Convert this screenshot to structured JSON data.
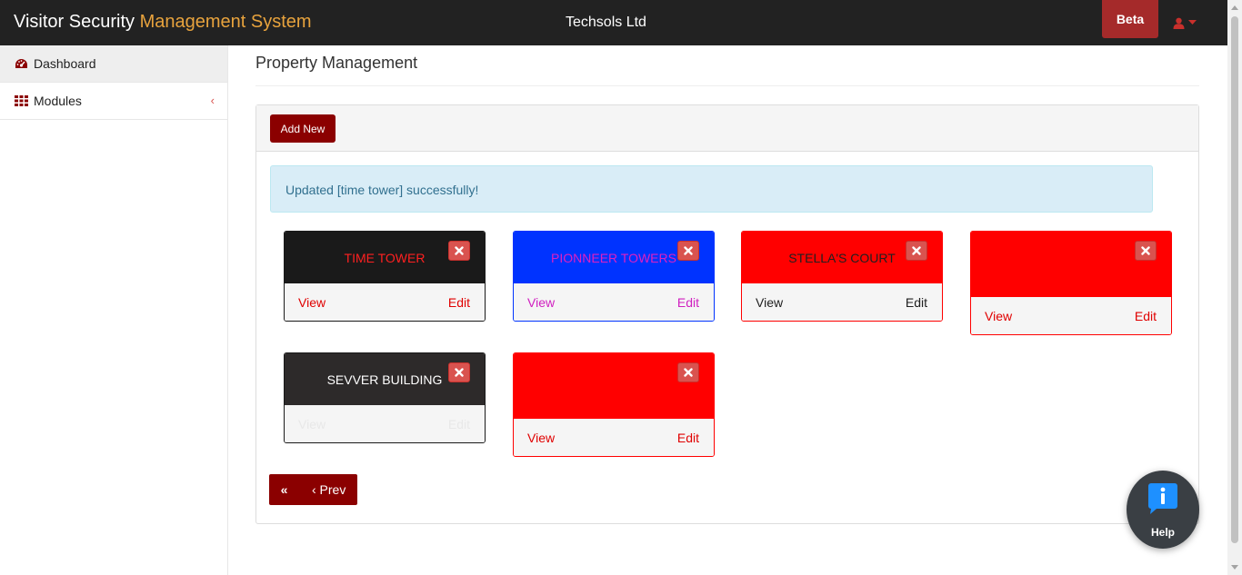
{
  "header": {
    "brand_part1": "Visitor Security ",
    "brand_part2": "Management System",
    "company": "Techsols Ltd",
    "beta_label": "Beta",
    "brand_accent_color": "#e8a33d",
    "user_icon": "user-icon",
    "caret_icon": "caret-down-icon"
  },
  "sidebar": {
    "items": [
      {
        "label": "Dashboard",
        "icon": "dashboard-icon"
      },
      {
        "label": "Modules",
        "icon": "grid-icon",
        "chevron": "‹"
      }
    ]
  },
  "main": {
    "page_title": "Property Management",
    "add_button": "Add New",
    "alert_text": "Updated [time tower] successfully!",
    "view_label": "View",
    "edit_label": "Edit",
    "cards": [
      {
        "name": "TIME TOWER",
        "top_bg": "#1a1a1a",
        "name_color": "#ff2020",
        "border": "#1a1a1a",
        "link_color": "#e00000",
        "faded": false
      },
      {
        "name": "PIONNEER TOWERS",
        "top_bg": "#0033ff",
        "name_color": "#e020c0",
        "border": "#0033ff",
        "link_color": "#d020c0",
        "faded": false
      },
      {
        "name": "STELLA'S COURT",
        "top_bg": "#ff0000",
        "name_color": "#202020",
        "border": "#ff0000",
        "link_color": "#202020",
        "faded": false
      },
      {
        "name": "",
        "top_bg": "#ff0000",
        "name_color": "#ffffff",
        "border": "#ff0000",
        "link_color": "#e00000",
        "faded": false
      },
      {
        "name": "SEVVER BUILDING",
        "top_bg": "#2d2a2a",
        "name_color": "#ffffff",
        "border": "#1a1a1a",
        "link_color": "#e8e8e8",
        "faded": true
      },
      {
        "name": "",
        "top_bg": "#ff0000",
        "name_color": "#ffffff",
        "border": "#ff0000",
        "link_color": "#e00000",
        "faded": false
      }
    ]
  },
  "pager": {
    "first": "«",
    "prev": "‹ Prev"
  },
  "help": {
    "label": "Help",
    "icon": "info-chat-icon"
  },
  "colors": {
    "primary_dark_red": "#8b0000",
    "beta_bg": "#a52a2a",
    "alert_bg": "#d9edf7",
    "alert_text": "#31708f"
  }
}
